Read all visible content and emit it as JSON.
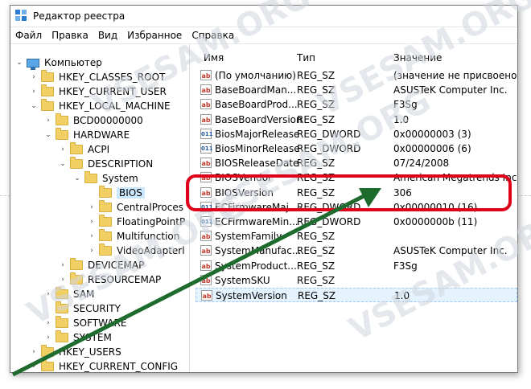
{
  "window": {
    "title": "Редактор реестра",
    "menu": [
      "Файл",
      "Правка",
      "Вид",
      "Избранное",
      "Справка"
    ]
  },
  "tree": [
    {
      "label": "Компьютер",
      "icon": "computer",
      "indent": 0,
      "expander": "⌄"
    },
    {
      "label": "HKEY_CLASSES_ROOT",
      "icon": "folder",
      "indent": 1,
      "expander": "›"
    },
    {
      "label": "HKEY_CURRENT_USER",
      "icon": "folder",
      "indent": 1,
      "expander": "›"
    },
    {
      "label": "HKEY_LOCAL_MACHINE",
      "icon": "folder",
      "indent": 1,
      "expander": "⌄"
    },
    {
      "label": "BCD00000000",
      "icon": "folder",
      "indent": 2,
      "expander": "›"
    },
    {
      "label": "HARDWARE",
      "icon": "folder",
      "indent": 2,
      "expander": "⌄"
    },
    {
      "label": "ACPI",
      "icon": "folder",
      "indent": 3,
      "expander": "›"
    },
    {
      "label": "DESCRIPTION",
      "icon": "folder",
      "indent": 3,
      "expander": "⌄"
    },
    {
      "label": "System",
      "icon": "folder",
      "indent": 4,
      "expander": "⌄"
    },
    {
      "label": "BIOS",
      "icon": "folder",
      "indent": 5,
      "expander": "",
      "selected": true
    },
    {
      "label": "CentralProces",
      "icon": "folder",
      "indent": 5,
      "expander": "›"
    },
    {
      "label": "FloatingPointP",
      "icon": "folder",
      "indent": 5,
      "expander": "›"
    },
    {
      "label": "Multifunction",
      "icon": "folder",
      "indent": 5,
      "expander": "›"
    },
    {
      "label": "VideoAdapterl",
      "icon": "folder",
      "indent": 5,
      "expander": "›"
    },
    {
      "label": "DEVICEMAP",
      "icon": "folder",
      "indent": 3,
      "expander": "›"
    },
    {
      "label": "RESOURCEMAP",
      "icon": "folder",
      "indent": 3,
      "expander": "›"
    },
    {
      "label": "SAM",
      "icon": "folder",
      "indent": 2,
      "expander": "›"
    },
    {
      "label": "SECURITY",
      "icon": "folder",
      "indent": 2,
      "expander": ""
    },
    {
      "label": "SOFTWARE",
      "icon": "folder",
      "indent": 2,
      "expander": "›"
    },
    {
      "label": "SYSTEM",
      "icon": "folder",
      "indent": 2,
      "expander": "›"
    },
    {
      "label": "HKEY_USERS",
      "icon": "folder",
      "indent": 1,
      "expander": "›"
    },
    {
      "label": "HKEY_CURRENT_CONFIG",
      "icon": "folder",
      "indent": 1,
      "expander": "›"
    }
  ],
  "list": {
    "headers": {
      "name": "Имя",
      "type": "Тип",
      "value": "Значение"
    },
    "rows": [
      {
        "name": "(По умолчанию)",
        "type": "REG_SZ",
        "value": "(значение не присвоено)",
        "icon": "sz"
      },
      {
        "name": "BaseBoardMan...",
        "type": "REG_SZ",
        "value": "ASUSTeK Computer Inc.",
        "icon": "sz"
      },
      {
        "name": "BaseBoardProd...",
        "type": "REG_SZ",
        "value": "F3Sg",
        "icon": "sz"
      },
      {
        "name": "BaseBoardVersion",
        "type": "REG_SZ",
        "value": "1.0",
        "icon": "sz"
      },
      {
        "name": "BiosMajorRelease",
        "type": "REG_DWORD",
        "value": "0x00000003 (3)",
        "icon": "bin"
      },
      {
        "name": "BiosMinorRelease",
        "type": "REG_DWORD",
        "value": "0x00000006 (6)",
        "icon": "bin"
      },
      {
        "name": "BIOSReleaseDate",
        "type": "REG_SZ",
        "value": "07/24/2008",
        "icon": "sz"
      },
      {
        "name": "BIOSVendor",
        "type": "REG_SZ",
        "value": "American Megatrends Inc.",
        "icon": "sz"
      },
      {
        "name": "BIOSVersion",
        "type": "REG_SZ",
        "value": "306",
        "icon": "sz"
      },
      {
        "name": "ECFirmwareMaj...",
        "type": "REG_DWORD",
        "value": "0x00000010 (16)",
        "icon": "bin"
      },
      {
        "name": "ECFirmwareMin...",
        "type": "REG_DWORD",
        "value": "0x0000000b (11)",
        "icon": "bin"
      },
      {
        "name": "SystemFamily",
        "type": "REG_SZ",
        "value": "",
        "icon": "sz"
      },
      {
        "name": "SystemManufac...",
        "type": "REG_SZ",
        "value": "ASUSTeK Computer Inc.",
        "icon": "sz"
      },
      {
        "name": "SystemProduct...",
        "type": "REG_SZ",
        "value": "F3Sg",
        "icon": "sz"
      },
      {
        "name": "SystemSKU",
        "type": "REG_SZ",
        "value": "",
        "icon": "sz"
      },
      {
        "name": "SystemVersion",
        "type": "REG_SZ",
        "value": "1.0",
        "icon": "sz",
        "selected": true
      }
    ]
  },
  "icon_labels": {
    "sz": "ab",
    "bin": "011"
  },
  "watermark": "VSESAM.ORG",
  "colors": {
    "highlight": "#e0001a",
    "arrow": "#1e6b2e"
  }
}
